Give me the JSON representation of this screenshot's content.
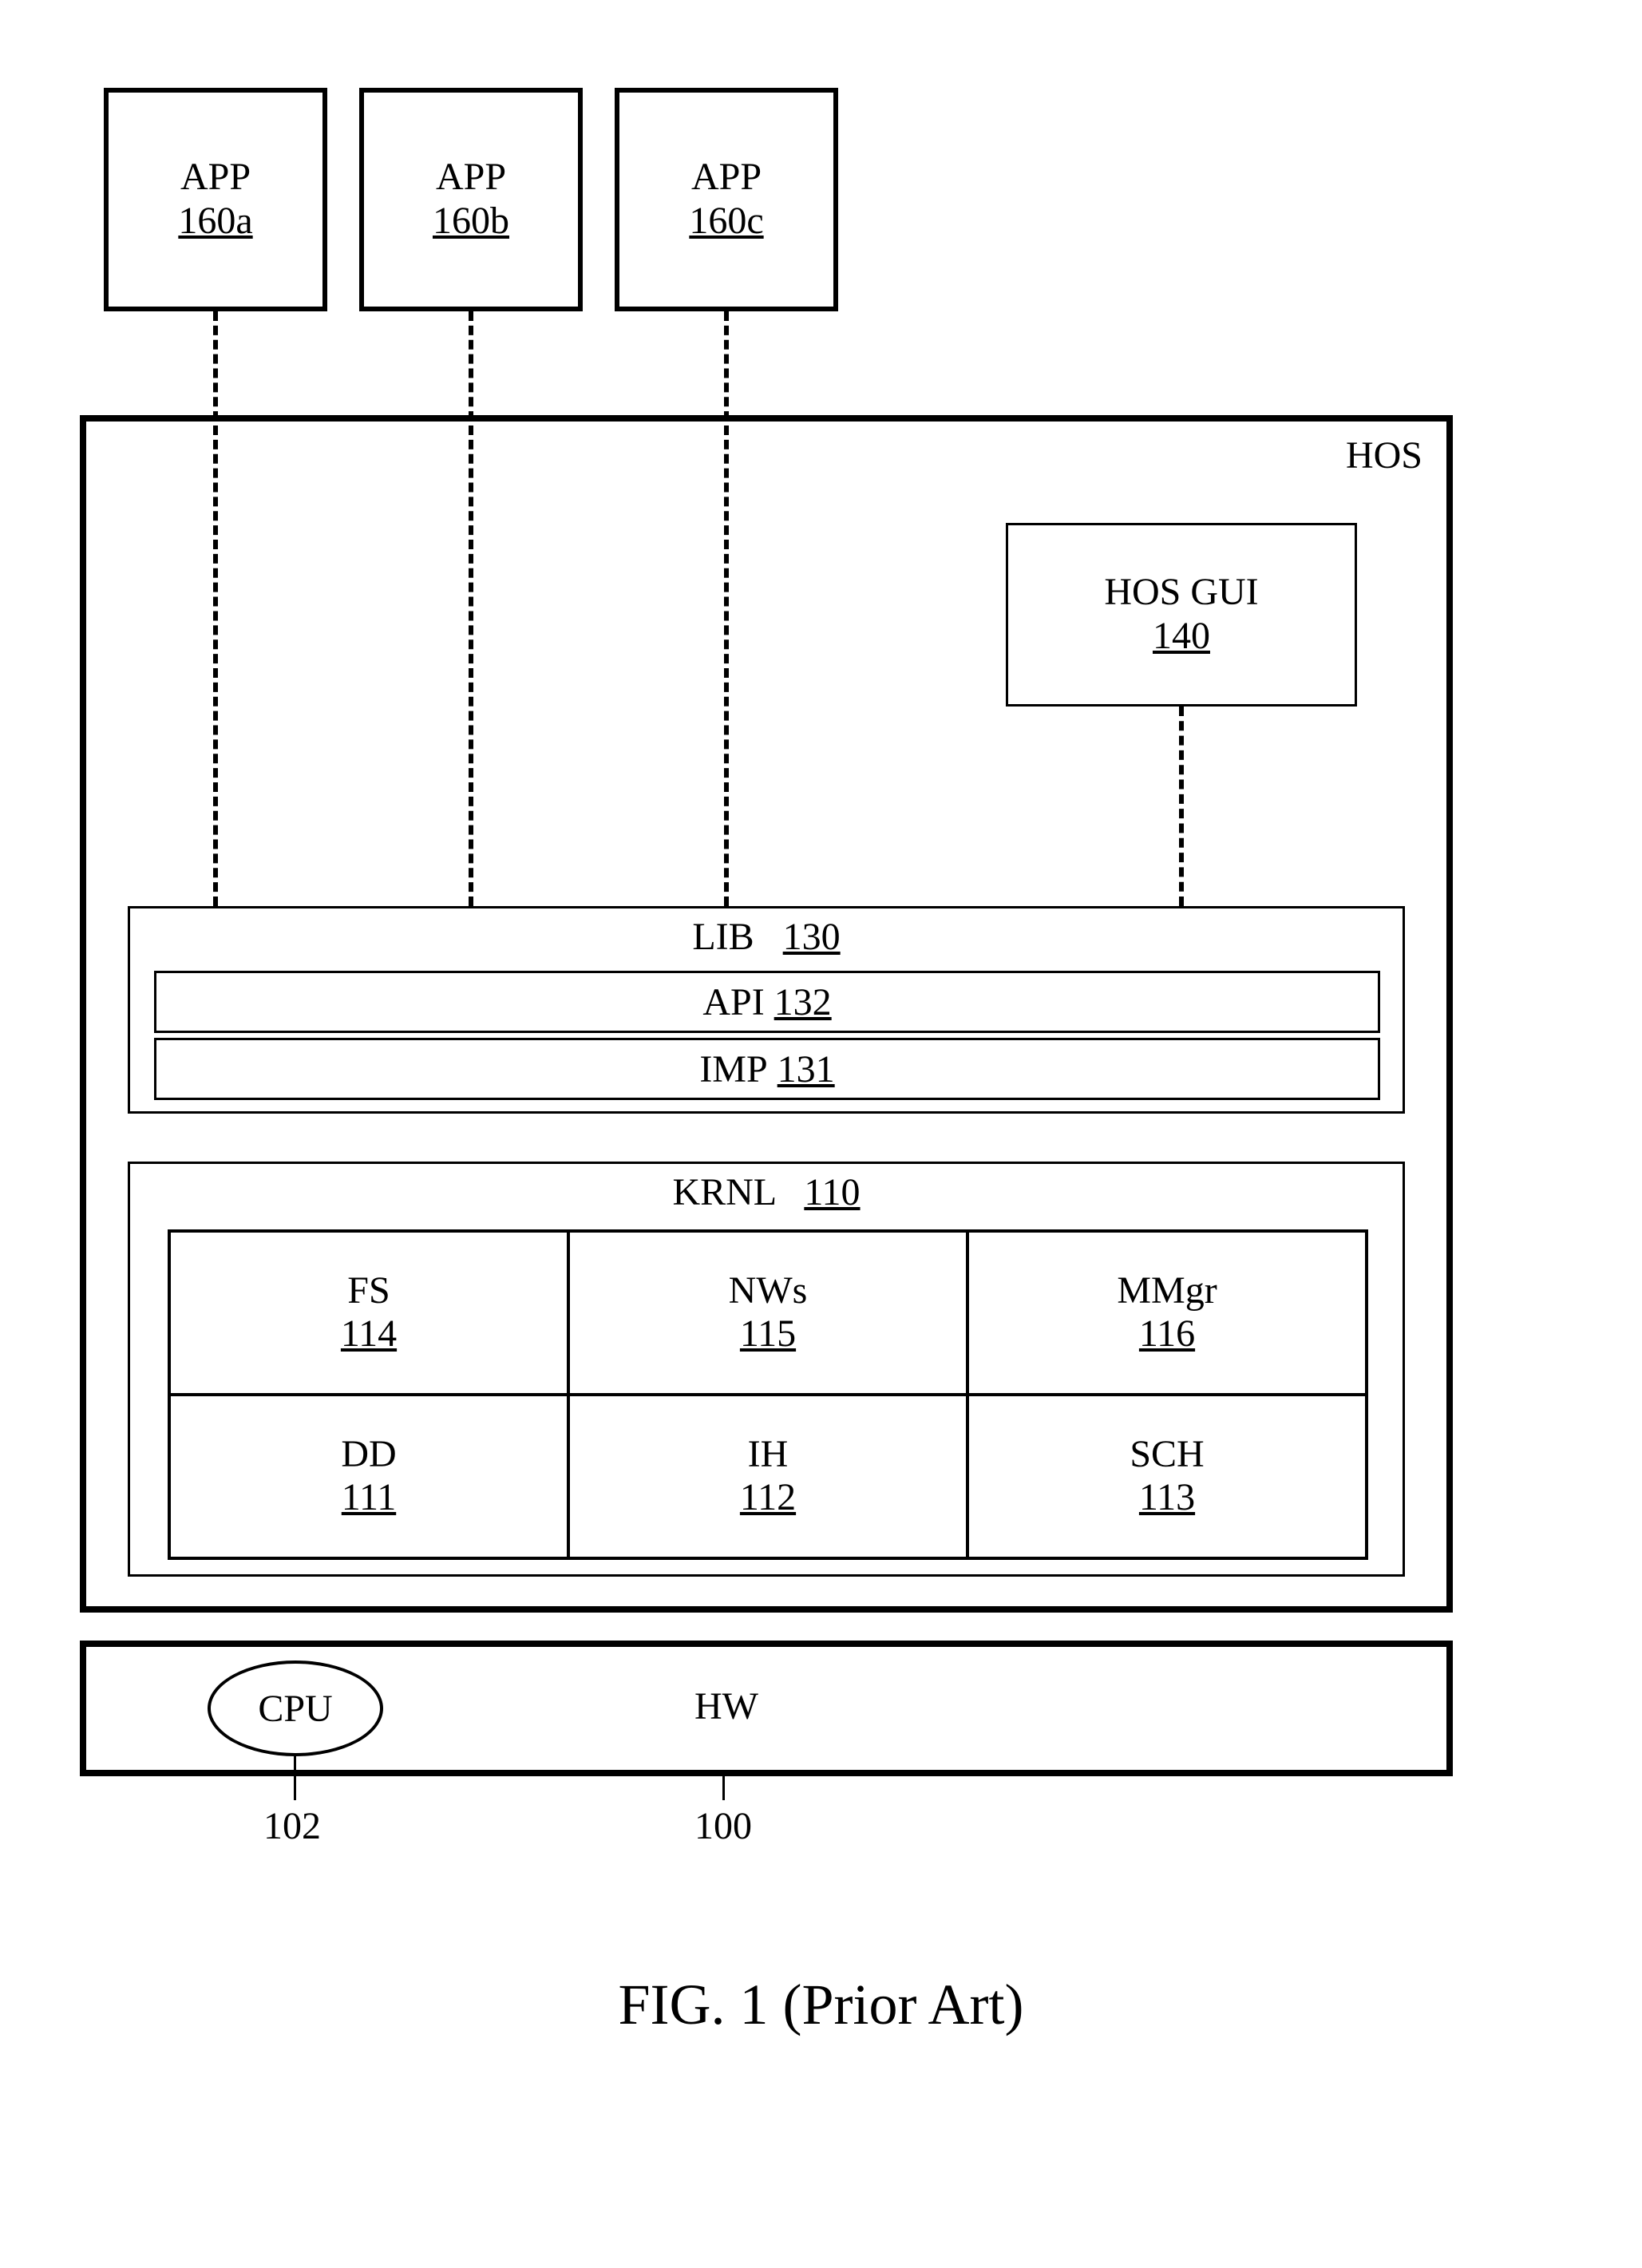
{
  "apps": [
    {
      "name": "APP",
      "num": "160a"
    },
    {
      "name": "APP",
      "num": "160b"
    },
    {
      "name": "APP",
      "num": "160c"
    }
  ],
  "hos": {
    "title": "HOS",
    "gui": {
      "name": "HOS GUI",
      "num": "140"
    },
    "lib": {
      "title_name": "LIB",
      "title_num": "130",
      "api": {
        "name": "API",
        "num": "132"
      },
      "imp": {
        "name": "IMP",
        "num": "131"
      }
    },
    "kernel": {
      "title_name": "KRNL",
      "title_num": "110",
      "cells": [
        {
          "name": "FS",
          "num": "114"
        },
        {
          "name": "NWs",
          "num": "115"
        },
        {
          "name": "MMgr",
          "num": "116"
        },
        {
          "name": "DD",
          "num": "111"
        },
        {
          "name": "IH",
          "num": "112"
        },
        {
          "name": "SCH",
          "num": "113"
        }
      ]
    }
  },
  "hw": {
    "title": "HW",
    "cpu": "CPU",
    "cpu_num": "102",
    "hw_num": "100"
  },
  "figure_caption": "FIG. 1 (Prior Art)"
}
